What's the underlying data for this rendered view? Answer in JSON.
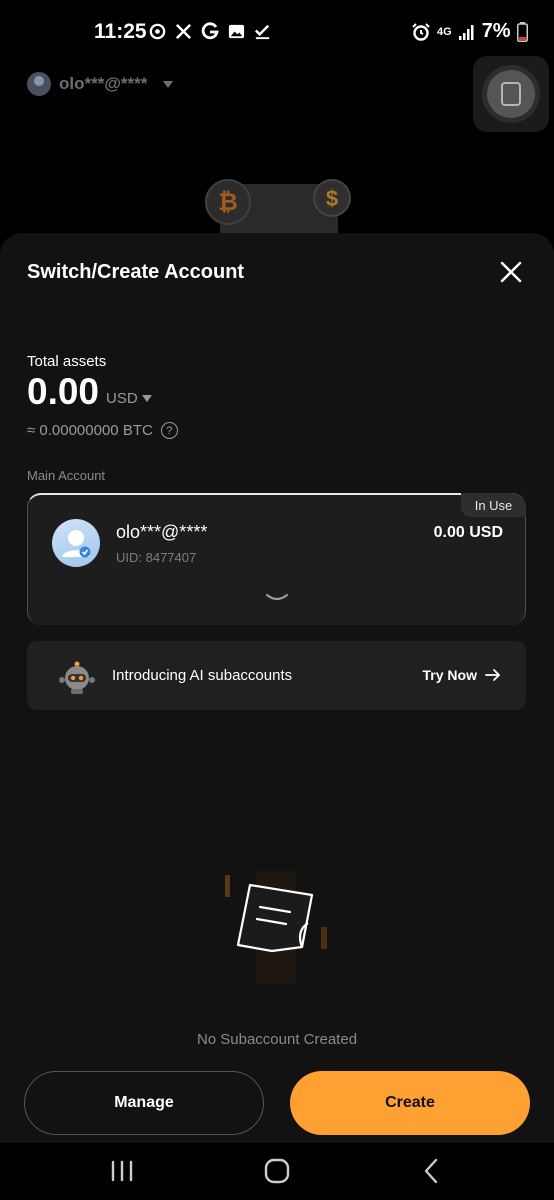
{
  "status_bar": {
    "time": "11:25",
    "network": "4G",
    "battery": "7%",
    "icons": [
      "sync-icon",
      "x-icon",
      "google-icon",
      "gallery-icon",
      "checkmark-icon",
      "alarm-icon",
      "signal-icon",
      "battery-icon"
    ]
  },
  "background": {
    "user_label": "olo***@****"
  },
  "sheet": {
    "title": "Switch/Create Account",
    "total_assets_label": "Total assets",
    "total_assets_value": "0.00",
    "currency": "USD",
    "btc_equivalent": "≈ 0.00000000 BTC",
    "main_account_label": "Main Account",
    "account": {
      "badge": "In Use",
      "name": "olo***@****",
      "uid": "UID: 8477407",
      "balance": "0.00 USD"
    },
    "ai_banner": {
      "text": "Introducing AI subaccounts",
      "cta": "Try Now"
    },
    "empty_state": "No Subaccount Created",
    "manage_label": "Manage",
    "create_label": "Create"
  },
  "colors": {
    "accent": "#ffa033",
    "sheet_bg": "#121212",
    "card_bg": "#1d1d1d"
  }
}
